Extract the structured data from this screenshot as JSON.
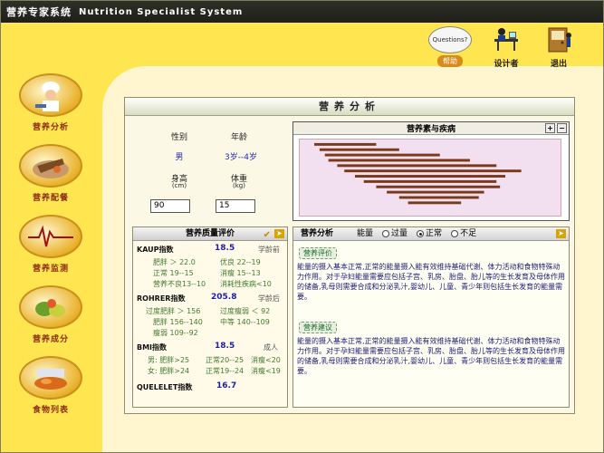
{
  "window": {
    "title_cn": "营养专家系统",
    "title_en": "Nutrition Specialist System"
  },
  "toolbar": {
    "help_bubble": "Questions?",
    "help_label": "帮助",
    "designer_label": "设计者",
    "exit_label": "退出"
  },
  "sidebar": {
    "items": [
      {
        "label": "营养分析"
      },
      {
        "label": "营养配餐"
      },
      {
        "label": "营养监测"
      },
      {
        "label": "营养成分"
      },
      {
        "label": "食物列表"
      }
    ]
  },
  "panel": {
    "title": "营养分析",
    "gender_label": "性别",
    "gender_value": "男",
    "age_label": "年龄",
    "age_value": "3岁--4岁",
    "height_label": "身高",
    "height_unit": "(cm)",
    "height_value": "90",
    "weight_label": "体重",
    "weight_unit": "(kg)",
    "weight_value": "15"
  },
  "chart": {
    "title": "营养素与疾病"
  },
  "quality": {
    "title": "营养质量评价",
    "kaup_label": "KAUP指数",
    "kaup_value": "18.5",
    "kaup_tag": "学龄前",
    "kaup_rows": [
      [
        "肥胖 ＞ 22.0",
        "优良 22--19"
      ],
      [
        "正常 19--15",
        "消瘦 15--13"
      ],
      [
        "营养不良13--10",
        "消耗性疾病<10"
      ]
    ],
    "rohrer_label": "ROHRER指数",
    "rohrer_value": "205.8",
    "rohrer_tag": "学龄后",
    "rohrer_rows": [
      [
        "过度肥胖 ＞ 156",
        "过度瘦弱 ＜ 92"
      ],
      [
        "肥胖 156--140",
        "中等 140--109"
      ],
      [
        "瘦弱 109--92",
        ""
      ]
    ],
    "bmi_label": "BMI指数",
    "bmi_value": "18.5",
    "bmi_tag": "成人",
    "bmi_rows": [
      [
        "男: 肥胖>25",
        "正常20--25",
        "消瘦<20"
      ],
      [
        "女: 肥胖>24",
        "正常19--24",
        "消瘦<19"
      ]
    ],
    "quelelet_label": "QUELELET指数",
    "quelelet_value": "16.7"
  },
  "analysis": {
    "title": "营养分析",
    "energy_label": "能量",
    "options": [
      "过量",
      "正常",
      "不足"
    ],
    "selected": "正常",
    "section1_title": "营养评价",
    "section1_text": "能量的摄入基本正常,正常的能量摄入能有效维持基础代谢、体力活动和食物特殊动力作用。对于孕妇能量需要应包括子宫、乳房、胎盘、胎儿等的生长发育及母体作用的储备,乳母则需要合成和分泌乳汁,婴幼儿、儿童、青少年则包括生长发育的能量需要。",
    "section2_title": "营养建议",
    "section2_text": "能量的摄入基本正常,正常的能量摄入能有效维持基础代谢、体力活动和食物特殊动力作用。对于孕妇能量需要应包括子宫、乳房、胎盘、胎儿等的生长发育及母体作用的储备,乳母则需要合成和分泌乳汁,婴幼儿、儿童、青少年则包括生长发育的能量需要。"
  }
}
